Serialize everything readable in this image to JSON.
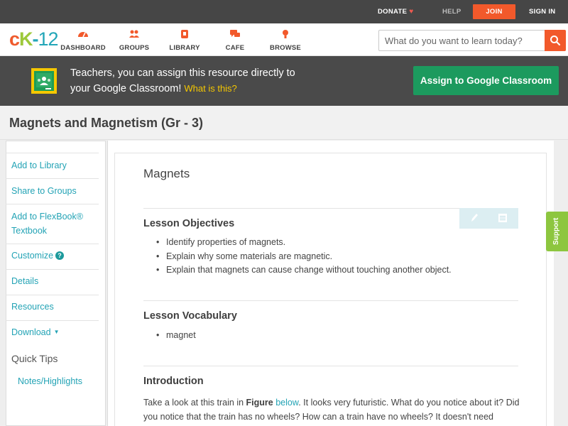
{
  "topbar": {
    "donate": "DONATE",
    "help": "HELP",
    "join": "JOIN",
    "signin": "SIGN IN"
  },
  "logo": {
    "c": "c",
    "k": "K",
    "dash": "-",
    "num": "12"
  },
  "nav": [
    {
      "label": "DASHBOARD",
      "icon": "dashboard-icon"
    },
    {
      "label": "GROUPS",
      "icon": "groups-icon"
    },
    {
      "label": "LIBRARY",
      "icon": "library-icon"
    },
    {
      "label": "CAFE",
      "icon": "cafe-icon"
    },
    {
      "label": "BROWSE",
      "icon": "browse-icon"
    }
  ],
  "search": {
    "placeholder": "What do you want to learn today?"
  },
  "banner": {
    "line1": "Teachers, you can assign this resource directly to",
    "line2": "your Google Classroom!",
    "what": "What is this?",
    "button": "Assign to Google Classroom"
  },
  "page_title": "Magnets and Magnetism (Gr - 3)",
  "sidebar": {
    "add_library": "Add to Library",
    "share_groups": "Share to Groups",
    "flexbook_line1": "Add to FlexBook®",
    "flexbook_line2": "Textbook",
    "customize": "Customize",
    "details": "Details",
    "resources": "Resources",
    "download": "Download",
    "quick_tips": "Quick Tips",
    "notes": "Notes/Highlights"
  },
  "doc": {
    "title": "Magnets",
    "objectives_heading": "Lesson Objectives",
    "objectives": [
      "Identify properties of magnets.",
      "Explain why some materials are magnetic.",
      "Explain that magnets can cause change without touching another object."
    ],
    "vocab_heading": "Lesson Vocabulary",
    "vocab": [
      "magnet"
    ],
    "intro_heading": "Introduction",
    "intro_p1": "Take a look at this train in ",
    "intro_figure": "Figure",
    "intro_space": " ",
    "intro_below": "below",
    "intro_p2": ". It looks very futuristic. What do you notice about it? Did you notice that the train has no wheels? How can a train have no wheels? It doesn't need"
  },
  "support": "Support",
  "colors": {
    "join": "#f2592b",
    "assign": "#1c9a5e",
    "link": "#23a3b5",
    "support": "#8dc63f"
  }
}
